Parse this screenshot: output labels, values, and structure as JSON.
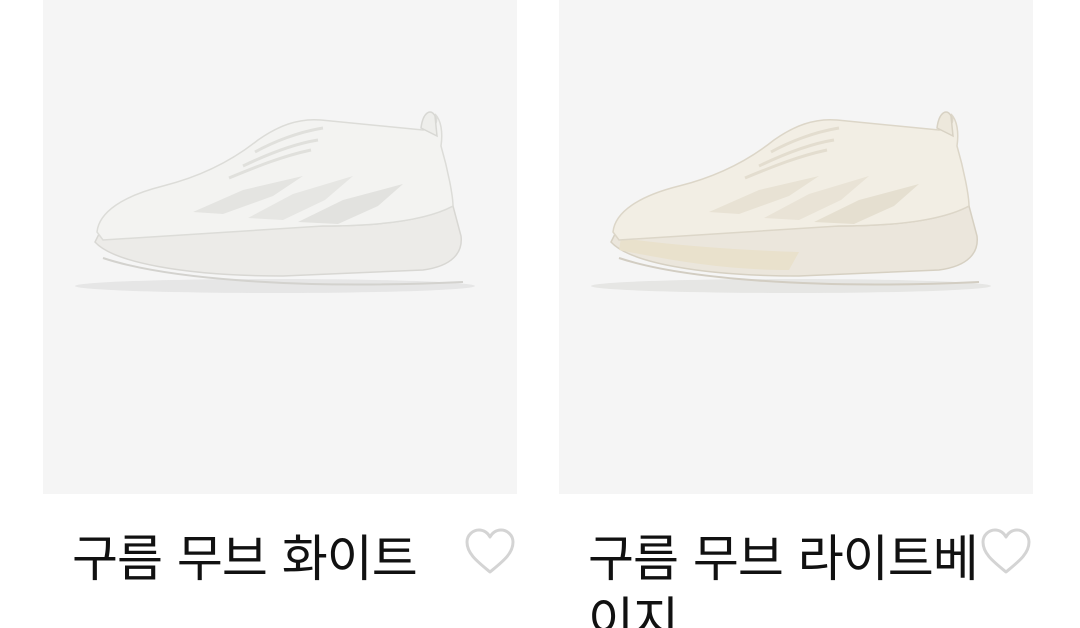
{
  "products": [
    {
      "name": "구름 무브 화이트",
      "wishlist_icon": "heart-outline-icon",
      "colors": {
        "background": "#f5f5f5",
        "shoe_upper": "#f3f3f1",
        "shoe_sole": "#ecebe8"
      }
    },
    {
      "name": "구름 무브 라이트베이지",
      "wishlist_icon": "heart-outline-icon",
      "colors": {
        "background": "#f5f5f5",
        "shoe_upper": "#f2eee4",
        "shoe_sole": "#e9e1cc"
      }
    }
  ]
}
